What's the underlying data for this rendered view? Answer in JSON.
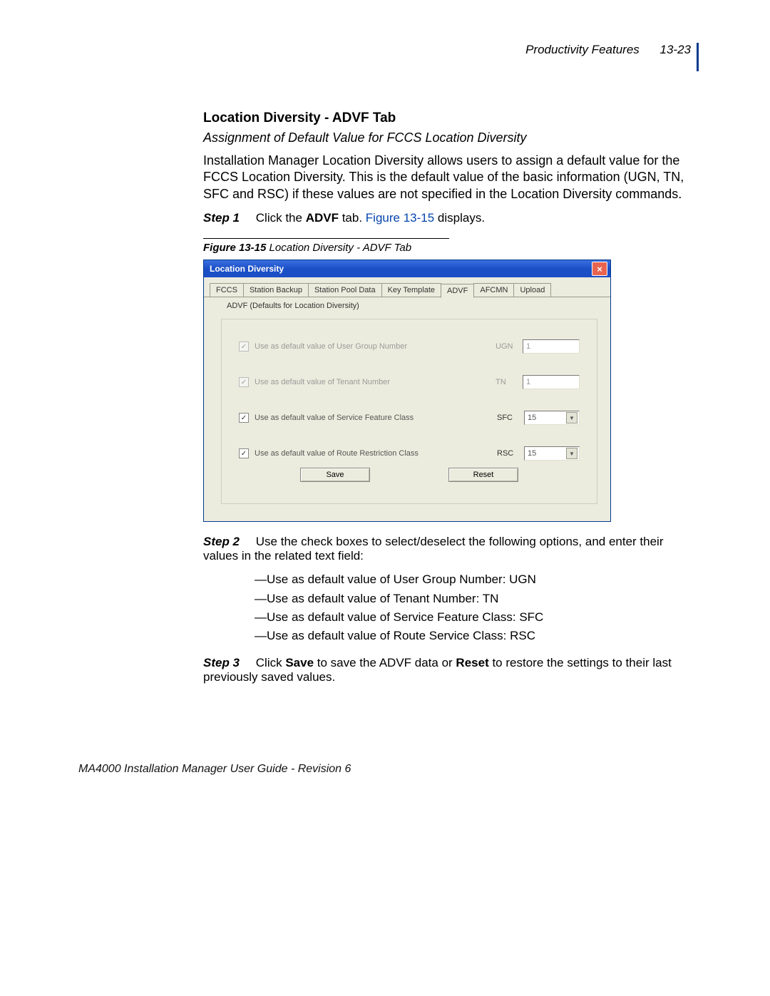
{
  "header": {
    "chapter": "Productivity Features",
    "page": "13-23"
  },
  "section": {
    "title": "Location Diversity - ADVF Tab",
    "subtitle": "Assignment of Default Value for FCCS Location Diversity",
    "intro": "Installation Manager Location Diversity allows users to assign a default value for the FCCS Location Diversity. This is the default value of the basic information (UGN, TN, SFC and RSC) if these values are not specified in the Location Diversity commands."
  },
  "steps": {
    "s1": {
      "label": "Step 1",
      "pre": "Click the ",
      "bold1": "ADVF",
      "mid": " tab. ",
      "link": "Figure 13-15",
      "post": " displays."
    },
    "s2": {
      "label": "Step 2",
      "text": "Use the check boxes to select/deselect the following options, and enter their values in the related text field:"
    },
    "s3": {
      "label": "Step 3",
      "pre": "Click ",
      "b1": "Save",
      "mid1": " to save the ADVF data or ",
      "b2": "Reset",
      "post": " to restore the settings to their last previously saved values."
    }
  },
  "options": {
    "o1": "Use as default value of User Group Number: UGN",
    "o2": "Use as default value of Tenant Number: TN",
    "o3": "Use as default value of Service Feature Class: SFC",
    "o4": "Use as default value of Route Service Class: RSC"
  },
  "figure": {
    "num": "Figure 13-15",
    "caption": "  Location Diversity - ADVF Tab"
  },
  "dialog": {
    "title": "Location Diversity",
    "tabs": {
      "t0": "FCCS",
      "t1": "Station Backup",
      "t2": "Station Pool Data",
      "t3": "Key Template",
      "t4": "ADVF",
      "t5": "AFCMN",
      "t6": "Upload"
    },
    "desc": "ADVF (Defaults for Location Diversity)",
    "rows": {
      "r1": {
        "label": "Use as default value of User Group Number",
        "code": "UGN",
        "value": "1"
      },
      "r2": {
        "label": "Use as default value of Tenant Number",
        "code": "TN",
        "value": "1"
      },
      "r3": {
        "label": "Use as default value of Service Feature Class",
        "code": "SFC",
        "value": "15"
      },
      "r4": {
        "label": "Use as default value of Route Restriction Class",
        "code": "RSC",
        "value": "15"
      }
    },
    "buttons": {
      "save": "Save",
      "reset": "Reset"
    },
    "check": "✓"
  },
  "footer": "MA4000 Installation Manager User Guide - Revision 6"
}
